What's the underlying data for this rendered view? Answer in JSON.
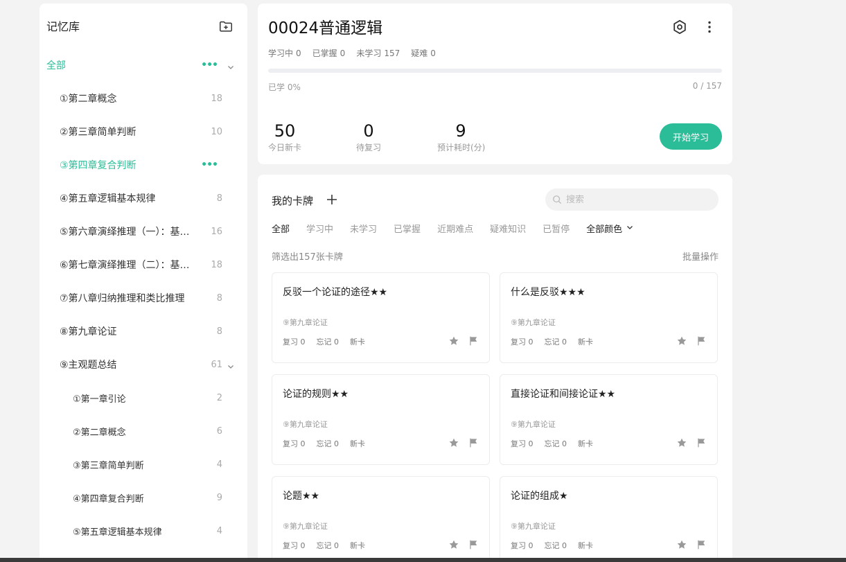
{
  "sidebar": {
    "title": "记忆库",
    "items": [
      {
        "label": "全部",
        "count": "",
        "level": 0,
        "dots": true,
        "expanded": true
      },
      {
        "label": "①第二章概念",
        "count": "18",
        "level": 1
      },
      {
        "label": "②第三章简单判断",
        "count": "10",
        "level": 1
      },
      {
        "label": "③第四章复合判断",
        "count": "",
        "level": 1,
        "active": true,
        "dots": true
      },
      {
        "label": "④第五章逻辑基本规律",
        "count": "8",
        "level": 1
      },
      {
        "label": "⑤第六章演绎推理（一）：基…",
        "count": "16",
        "level": 1
      },
      {
        "label": "⑥第七章演绎推理（二）：基…",
        "count": "18",
        "level": 1
      },
      {
        "label": "⑦第八章归纳推理和类比推理",
        "count": "8",
        "level": 1
      },
      {
        "label": "⑧第九章论证",
        "count": "8",
        "level": 1
      },
      {
        "label": "⑨主观题总结",
        "count": "61",
        "level": 1,
        "expanded": true
      },
      {
        "label": "①第一章引论",
        "count": "2",
        "level": 2
      },
      {
        "label": "②第二章概念",
        "count": "6",
        "level": 2
      },
      {
        "label": "③第三章简单判断",
        "count": "4",
        "level": 2
      },
      {
        "label": "④第四章复合判断",
        "count": "9",
        "level": 2
      },
      {
        "label": "⑤第五章逻辑基本规律",
        "count": "4",
        "level": 2
      }
    ]
  },
  "deck": {
    "title": "00024普通逻辑",
    "stats": [
      {
        "label": "学习中",
        "value": "0"
      },
      {
        "label": "已掌握",
        "value": "0"
      },
      {
        "label": "未学习",
        "value": "157"
      },
      {
        "label": "疑难",
        "value": "0"
      }
    ],
    "progress_fraction": 0,
    "learned_label": "已学 0%",
    "learned_count": "0 / 157",
    "big_stats": [
      {
        "value": "50",
        "caption": "今日新卡"
      },
      {
        "value": "0",
        "caption": "待复习"
      },
      {
        "value": "9",
        "caption": "预计耗时(分)"
      }
    ],
    "start_button": "开始学习"
  },
  "cards_panel": {
    "title": "我的卡牌",
    "search_placeholder": "搜索",
    "tabs": [
      "全部",
      "学习中",
      "未学习",
      "已掌握",
      "近期难点",
      "疑难知识",
      "已暂停"
    ],
    "color_filter": "全部颜色",
    "count_line": "筛选出157张卡牌",
    "batch_op": "批量操作",
    "cards": [
      {
        "title": "反驳一个论证的途径★★",
        "deck": "⑨第九章论证",
        "review": "复习 0",
        "forget": "忘记 0",
        "status": "新卡"
      },
      {
        "title": "什么是反驳★★★",
        "deck": "⑨第九章论证",
        "review": "复习 0",
        "forget": "忘记 0",
        "status": "新卡"
      },
      {
        "title": "论证的规则★★",
        "deck": "⑨第九章论证",
        "review": "复习 0",
        "forget": "忘记 0",
        "status": "新卡"
      },
      {
        "title": "直接论证和间接论证★★",
        "deck": "⑨第九章论证",
        "review": "复习 0",
        "forget": "忘记 0",
        "status": "新卡"
      },
      {
        "title": "论题★★",
        "deck": "⑨第九章论证",
        "review": "复习 0",
        "forget": "忘记 0",
        "status": "新卡"
      },
      {
        "title": "论证的组成★",
        "deck": "⑨第九章论证",
        "review": "复习 0",
        "forget": "忘记 0",
        "status": "新卡"
      }
    ]
  },
  "icons": {
    "add_deck": "folder-plus-icon",
    "settings": "settings-icon",
    "more": "more-vertical-icon",
    "add_card": "plus-icon",
    "search": "search-icon",
    "star": "star-icon",
    "flag": "flag-icon",
    "chevron": "chevron-down-icon"
  },
  "colors": {
    "accent": "#2bbc98",
    "background": "#f3f3f3",
    "card_border": "#ececec"
  }
}
